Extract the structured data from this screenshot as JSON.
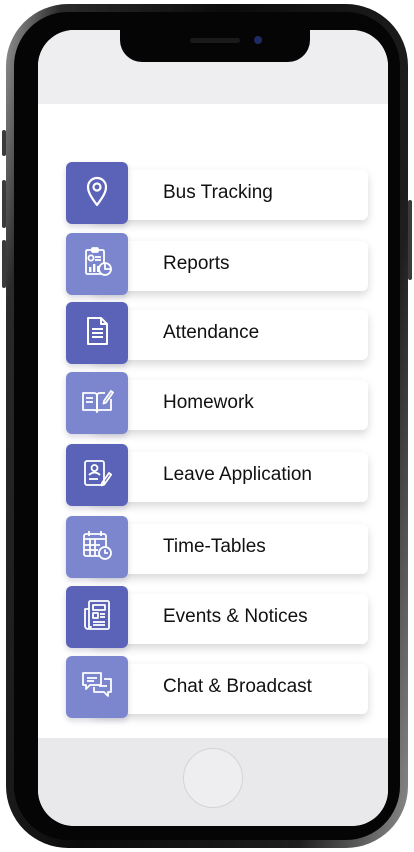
{
  "menu": {
    "items": [
      {
        "label": "Bus Tracking",
        "icon": "location-pin-icon",
        "color": "#5b63b8"
      },
      {
        "label": "Reports",
        "icon": "report-chart-icon",
        "color": "#7b86cf"
      },
      {
        "label": "Attendance",
        "icon": "document-icon",
        "color": "#5b63b8"
      },
      {
        "label": "Homework",
        "icon": "book-pencil-icon",
        "color": "#7b86cf"
      },
      {
        "label": "Leave Application",
        "icon": "leave-form-icon",
        "color": "#5b63b8"
      },
      {
        "label": "Time-Tables",
        "icon": "calendar-clock-icon",
        "color": "#7b86cf"
      },
      {
        "label": "Events & Notices",
        "icon": "newspaper-icon",
        "color": "#5b63b8"
      },
      {
        "label": "Chat & Broadcast",
        "icon": "chat-bubbles-icon",
        "color": "#7b86cf"
      }
    ]
  },
  "colors": {
    "tile_dark": "#5b63b8",
    "tile_light": "#7b86cf",
    "card_background": "#ffffff",
    "label_text": "#111111"
  }
}
